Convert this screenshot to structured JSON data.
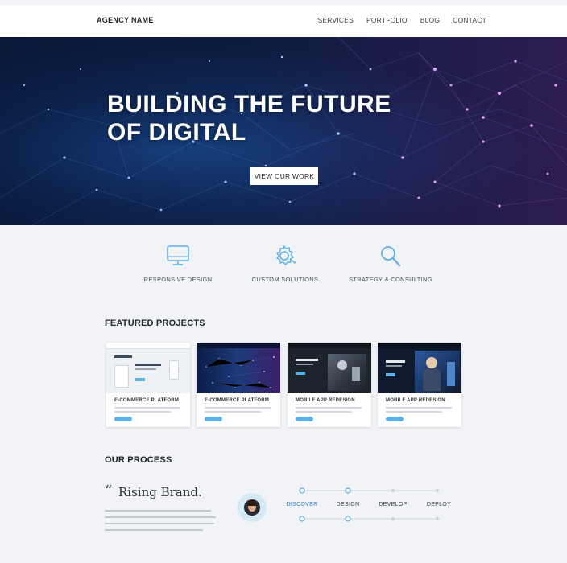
{
  "nav": {
    "brand": "AGENCY NAME",
    "links": [
      "SERVICES",
      "PORTFOLIO",
      "BLOG",
      "CONTACT"
    ]
  },
  "hero": {
    "title_line1": "BUILDING THE FUTURE",
    "title_line2": "OF DIGITAL",
    "cta": "VIEW OUR WORK"
  },
  "services": [
    {
      "icon": "monitor-icon",
      "label": "RESPONSIVE DESIGN"
    },
    {
      "icon": "gear-icon",
      "label": "CUSTOM SOLUTIONS"
    },
    {
      "icon": "magnifier-icon",
      "label": "STRATEGY & CONSULTING"
    }
  ],
  "featured": {
    "title": "FEATURED PROJECTS",
    "projects": [
      {
        "title": "E-COMMERCE PLATFORM"
      },
      {
        "title": "E-COMMERCE PLATFORM"
      },
      {
        "title": "MOBILE APP REDESIGN"
      },
      {
        "title": "MOBILE APP REDESIGN"
      }
    ]
  },
  "process": {
    "title": "OUR PROCESS",
    "quote_mark": "“",
    "quote": "Rising Brand.",
    "steps": [
      "DISCOVER",
      "DESIGN",
      "DEVELOP",
      "DEPLOY"
    ],
    "active_step": 0
  },
  "colors": {
    "accent": "#5fb0e8",
    "active_step": "#2f7fc0",
    "hero_left": "#0f2550",
    "hero_right": "#5a1b6e"
  }
}
